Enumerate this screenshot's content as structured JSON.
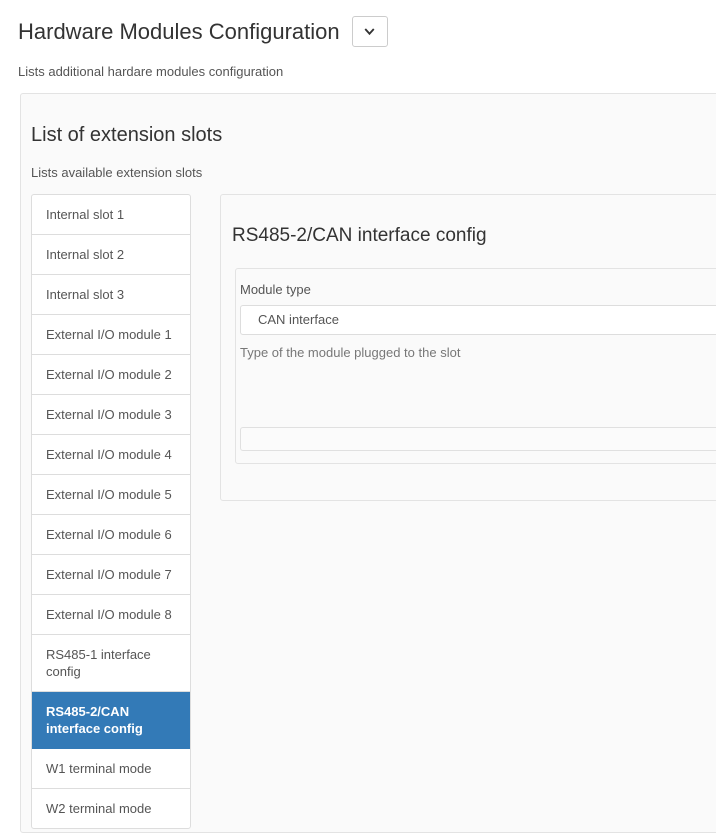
{
  "header": {
    "title": "Hardware Modules Configuration",
    "toggle_icon": "chevron-down-icon",
    "subtitle": "Lists additional hardare modules configuration"
  },
  "section": {
    "title": "List of extension slots",
    "subtitle": "Lists available extension slots"
  },
  "slots": [
    {
      "label": "Internal slot 1",
      "selected": false
    },
    {
      "label": "Internal slot 2",
      "selected": false
    },
    {
      "label": "Internal slot 3",
      "selected": false
    },
    {
      "label": "External I/O module 1",
      "selected": false
    },
    {
      "label": "External I/O module 2",
      "selected": false
    },
    {
      "label": "External I/O module 3",
      "selected": false
    },
    {
      "label": "External I/O module 4",
      "selected": false
    },
    {
      "label": "External I/O module 5",
      "selected": false
    },
    {
      "label": "External I/O module 6",
      "selected": false
    },
    {
      "label": "External I/O module 7",
      "selected": false
    },
    {
      "label": "External I/O module 8",
      "selected": false
    },
    {
      "label": "RS485-1 interface config",
      "selected": false
    },
    {
      "label": "RS485-2/CAN interface config",
      "selected": true
    },
    {
      "label": "W1 terminal mode",
      "selected": false
    },
    {
      "label": "W2 terminal mode",
      "selected": false
    }
  ],
  "detail": {
    "title": "RS485-2/CAN interface config",
    "module_type": {
      "label": "Module type",
      "value": "CAN interface",
      "help": "Type of the module plugged to the slot"
    },
    "action_bar_label": ""
  },
  "colors": {
    "accent": "#337ab7",
    "panel_background": "#fafafa",
    "border": "#dddddd",
    "text": "#555555"
  }
}
